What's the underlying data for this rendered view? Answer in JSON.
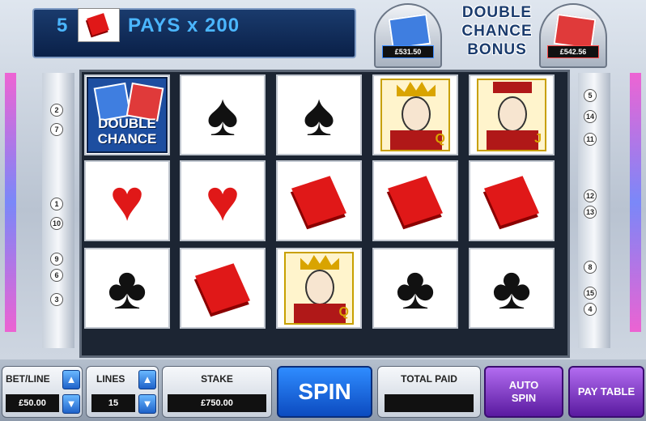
{
  "banner": {
    "count": "5",
    "text": "PAYS x 200",
    "symbol_icon": "diamond-icon"
  },
  "jackpots": {
    "left": {
      "value": "£531.50",
      "color": "#3a8bff"
    },
    "right": {
      "value": "£542.56",
      "color": "#ff4a4a"
    },
    "logo_line1": "DOUBLE",
    "logo_line2": "CHANCE",
    "logo_line3": "BONUS"
  },
  "paylines": {
    "left": [
      "2",
      "7",
      "1",
      "10",
      "9",
      "6",
      "3"
    ],
    "right": [
      "5",
      "14",
      "11",
      "12",
      "13",
      "8",
      "15",
      "4"
    ]
  },
  "reels": {
    "rows": [
      [
        "double-chance",
        "spade",
        "spade",
        "queen",
        "jack"
      ],
      [
        "heart",
        "heart",
        "diamond",
        "diamond",
        "diamond"
      ],
      [
        "club",
        "diamond",
        "queen",
        "club",
        "club"
      ]
    ],
    "double_chance_line1": "DOUBLE",
    "double_chance_line2": "CHANCE",
    "queen_letter": "Q",
    "jack_letter": "J"
  },
  "controls": {
    "bet_line_label": "BET/LINE",
    "bet_line_value": "£50.00",
    "lines_label": "LINES",
    "lines_value": "15",
    "stake_label": "STAKE",
    "stake_value": "£750.00",
    "spin_label": "SPIN",
    "total_paid_label": "TOTAL PAID",
    "total_paid_value": "",
    "auto_spin_label": "AUTO SPIN",
    "pay_table_label": "PAY TABLE"
  }
}
